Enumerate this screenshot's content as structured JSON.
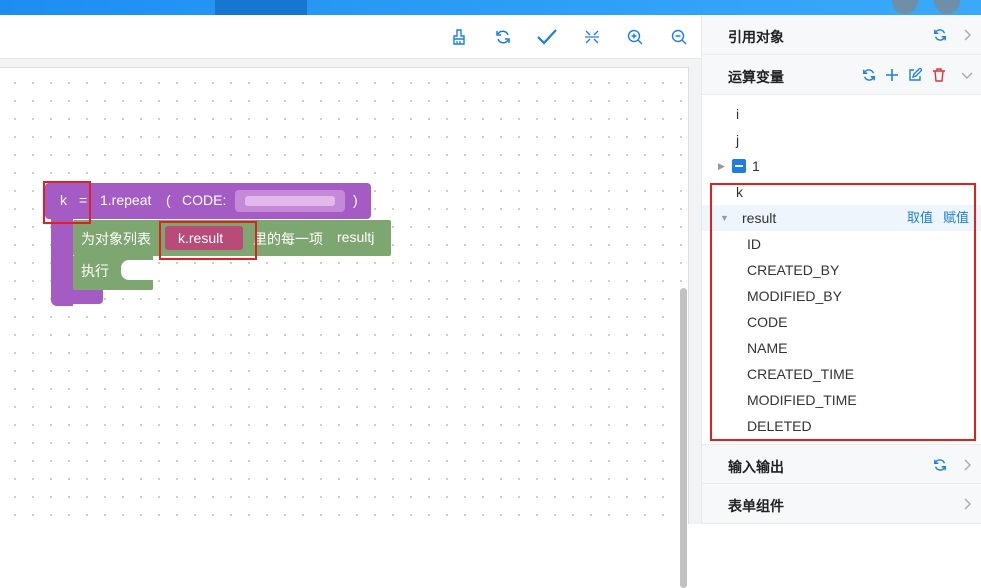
{
  "toolbar": {
    "tools": [
      {
        "name": "brush-icon"
      },
      {
        "name": "refresh-icon"
      },
      {
        "name": "check-icon"
      },
      {
        "name": "collapse-icon"
      },
      {
        "name": "zoom-in-icon"
      },
      {
        "name": "zoom-out-icon"
      }
    ]
  },
  "blocks": {
    "var_name": "k",
    "equals": "=",
    "call": "1.repeat",
    "paren_open": "(",
    "code_label": "CODE:",
    "paren_close": ")",
    "foreach_prefix": "为对象列表",
    "list_value": "k.result",
    "foreach_suffix": "里的每一项",
    "item_var": "resultj",
    "exec_label": "执行"
  },
  "panel": {
    "ref_objects": "引用对象",
    "variables": "运算变量",
    "io": "输入输出",
    "form_components": "表单组件",
    "tree": {
      "i": "i",
      "j": "j",
      "one": "1",
      "k": "k",
      "result": "result",
      "take_value": "取值",
      "assign_value": "赋值",
      "fields": [
        "ID",
        "CREATED_BY",
        "MODIFIED_BY",
        "CODE",
        "NAME",
        "CREATED_TIME",
        "MODIFIED_TIME",
        "DELETED"
      ]
    }
  },
  "colors": {
    "accent": "#1a7fe0",
    "block_purple": "#a55bc4",
    "block_green": "#7ea671",
    "list_block": "#b94b79",
    "highlight_red": "#e0201e"
  }
}
